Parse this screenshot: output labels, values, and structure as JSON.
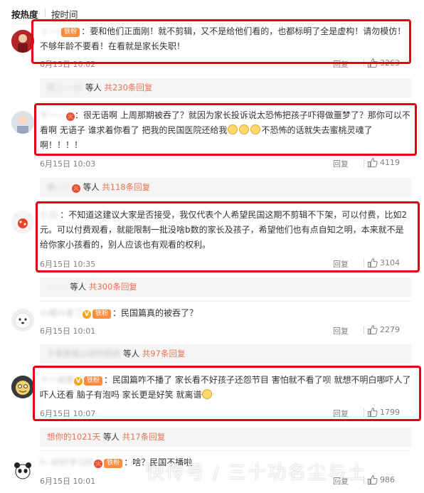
{
  "sort": {
    "hot": "按热度",
    "time": "按时间"
  },
  "comments": [
    {
      "user": "-J -- i",
      "text": "：要和他们正面刚！就不剪辑，又不是给他们看的，也都标明了全是虚构！请勿模仿！不够年龄不要看！在看就是家长失职！",
      "time": "6月15日 10:02",
      "reply": "回复",
      "likes": "3263"
    },
    {
      "user": "于一---",
      "text_a": "：很无语啊 上周那期被吞了？就因为家长投诉说太恐怖把孩子吓得做噩梦了？那你可以不看啊 无语子 谁求着你看了 把我的民国医院还给我",
      "text_b": "不恐怖的话就失去蜜桃灵魂了啊！！！！",
      "time": "6月15日 10:03",
      "reply": "回复",
      "likes": "4119"
    },
    {
      "user": "小瓜-",
      "text": "：不知道这建议大家是否接受，我仅代表个人希望民国这期不剪辑不下架，可以付费，比如2元。可以付费观看，就能限制一批没啥b数的家长及孩子，希望他们也有点自知之明，本来就不是给你家小孩看的，别人应该也有观看的权利。",
      "time": "6月15日 10:35",
      "reply": "回复",
      "likes": "3104"
    },
    {
      "user": "小猪兴奋了",
      "text": "：民国篇真的被吞了？",
      "time": "6月15日 10:01",
      "reply": "回复",
      "likes": "2279"
    },
    {
      "user": "十一候想",
      "text": "：民国篇咋不播了 家长看不好孩子还怨节目 害怕就不看了呗 就想不明白哪吓人了 吓人还看 脑子有泡吗 家长更是好笑 就离谱",
      "time": "6月15日 10:07",
      "reply": "回复",
      "likes": "1799"
    },
    {
      "user": "h--好好学习的",
      "text": "：啥？民国不播啦",
      "time": "6月15日 10:01",
      "reply": "回复",
      "likes": "986"
    }
  ],
  "reply_summaries": [
    {
      "names": "哈二-一川",
      "suffix": "等人",
      "count": "共230条回复"
    },
    {
      "names": "倩--一",
      "suffix": "等人",
      "count": "共118条回复"
    },
    {
      "names": "--- ---",
      "suffix": "等人",
      "count": "共300条回复"
    },
    {
      "names": "不要要看以前的民民",
      "suffix": "等人",
      "count": "共97条回复"
    },
    {
      "names": "想你的1021天",
      "suffix": "等人",
      "count": "共17条回复"
    }
  ],
  "badges": {
    "fan": "铁粉",
    "vip": "V"
  },
  "watermark": "快传号 / 三十功名尘与土",
  "colors": {
    "accent": "#eb7350",
    "highlight_box": "#e60012",
    "badge": "#ff8b3d"
  },
  "icons": {
    "like": "thumbs-up-icon",
    "emoji": "crying-face-emoji-icon"
  }
}
